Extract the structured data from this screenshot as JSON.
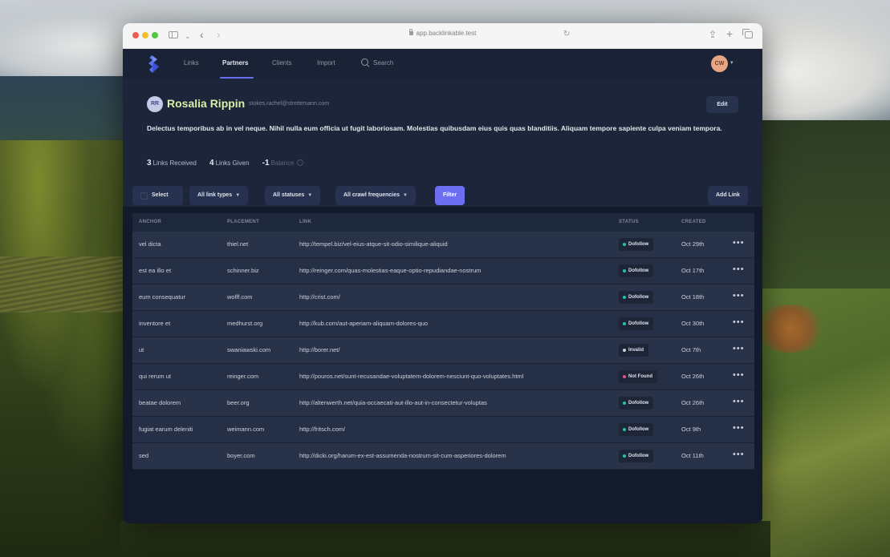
{
  "browser": {
    "url": "app.backlinkable.test"
  },
  "nav": {
    "items": [
      {
        "label": "Links"
      },
      {
        "label": "Partners"
      },
      {
        "label": "Clients"
      },
      {
        "label": "Import"
      }
    ],
    "search_label": "Search",
    "user_initials": "CW"
  },
  "profile": {
    "avatar_initials": "RR",
    "name": "Rosalia Rippin",
    "email": "stokes.rachel@streitemann.com",
    "edit_label": "Edit",
    "bio": "Delectus temporibus ab in vel neque. Nihil nulla eum officia ut fugit laboriosam. Molestias quibusdam eius quis quas blanditiis. Aliquam tempore sapiente culpa veniam tempora.",
    "stats": {
      "received_count": "3",
      "received_label": "Links Received",
      "given_count": "4",
      "given_label": "Links Given",
      "balance_value": "-1",
      "balance_label": "Balance"
    }
  },
  "filters": {
    "select_label": "Select",
    "link_types": "All link types",
    "statuses": "All statuses",
    "crawl": "All crawl frequencies",
    "filter_label": "Filter",
    "add_link_label": "Add Link"
  },
  "table": {
    "headers": {
      "anchor": "ANCHOR",
      "placement": "PLACEMENT",
      "link": "LINK",
      "status": "STATUS",
      "created": "CREATED"
    },
    "rows": [
      {
        "anchor": "vel dicta",
        "placement": "thiel.net",
        "link": "http://tempel.biz/vel-eius-atque-sit-odio-similique-aliquid",
        "status": "Dofollow",
        "created": "Oct 29th"
      },
      {
        "anchor": "est ea illo et",
        "placement": "schinner.biz",
        "link": "http://reinger.com/quas-molestias-eaque-optio-repudiandae-nostrum",
        "status": "Dofollow",
        "created": "Oct 17th"
      },
      {
        "anchor": "eum consequatur",
        "placement": "wolff.com",
        "link": "http://crist.com/",
        "status": "Dofollow",
        "created": "Oct 18th"
      },
      {
        "anchor": "inventore et",
        "placement": "medhurst.org",
        "link": "http://kub.com/aut-aperiam-aliquam-dolores-quo",
        "status": "Dofollow",
        "created": "Oct 30th"
      },
      {
        "anchor": "ut",
        "placement": "swaniawski.com",
        "link": "http://borer.net/",
        "status": "Invalid",
        "created": "Oct 7th"
      },
      {
        "anchor": "qui rerum ut",
        "placement": "reinger.com",
        "link": "http://pouros.net/sunt-recusandae-voluptatem-dolorem-nesciunt-quo-voluptates.html",
        "status": "Not Found",
        "created": "Oct 26th"
      },
      {
        "anchor": "beatae dolorem",
        "placement": "beer.org",
        "link": "http://altenwerth.net/quia-occaecati-aut-illo-aut-in-consectetur-voluptas",
        "status": "Dofollow",
        "created": "Oct 26th"
      },
      {
        "anchor": "fugiat earum deleniti",
        "placement": "weimann.com",
        "link": "http://fritsch.com/",
        "status": "Dofollow",
        "created": "Oct 9th"
      },
      {
        "anchor": "sed",
        "placement": "boyer.com",
        "link": "http://dicki.org/harum-ex-est-assumenda-nostrum-sit-cum-asperiores-dolorem",
        "status": "Dofollow",
        "created": "Oct 11th"
      }
    ]
  },
  "colors": {
    "accent": "#6d6ff3",
    "dofollow_dot": "#22c3a6",
    "invalid_dot": "#c9cfdb",
    "not_found_dot": "#e8508a"
  }
}
